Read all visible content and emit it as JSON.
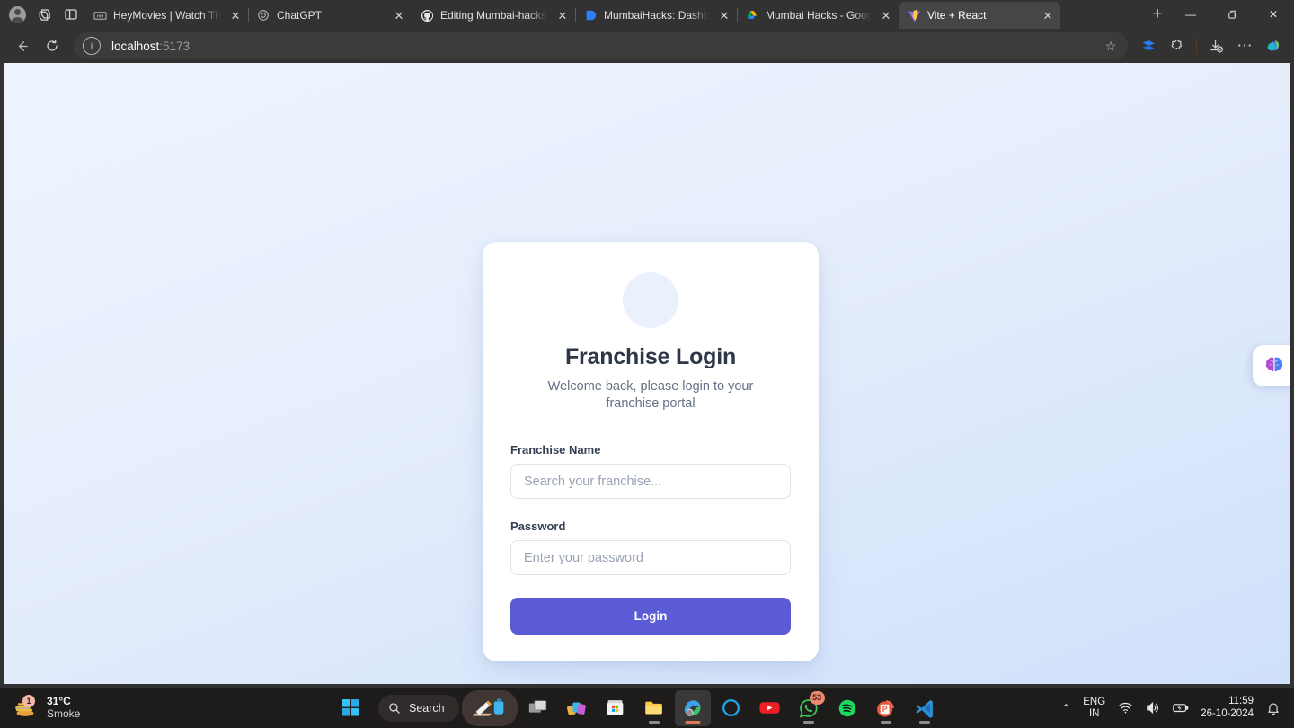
{
  "browser": {
    "profile_icon": "account-avatar-icon",
    "workspaces_icon": "workspaces-icon",
    "tab_actions_icon": "tab-actions-icon",
    "tabs": [
      {
        "title": "HeyMovies | Watch The H",
        "favicon": "heymovies-icon",
        "active": false
      },
      {
        "title": "ChatGPT",
        "favicon": "chatgpt-icon",
        "active": false
      },
      {
        "title": "Editing Mumbai-hacks/RE",
        "favicon": "github-icon",
        "active": false
      },
      {
        "title": "MumbaiHacks: Dashboard",
        "favicon": "dashboard-icon",
        "active": false
      },
      {
        "title": "Mumbai Hacks - Google D",
        "favicon": "google-drive-icon",
        "active": false
      },
      {
        "title": "Vite + React",
        "favicon": "vite-icon",
        "active": true
      }
    ],
    "new_tab_label": "+",
    "window_controls": {
      "minimize": "—",
      "maximize": "❐",
      "close": "✕"
    },
    "nav": {
      "back": "←",
      "reload": "↻"
    },
    "address": {
      "info_icon": "site-info-icon",
      "host": "localhost",
      "port": ":5173"
    },
    "star_label": "☆",
    "toolbar_icons": [
      "split-screen-icon",
      "extensions-icon",
      "downloads-icon",
      "settings-more-icon",
      "copilot-icon"
    ],
    "settings_more_label": "⋯"
  },
  "page": {
    "brand_icon": "brand-avatar-placeholder",
    "title": "Franchise Login",
    "subtitle": "Welcome back, please login to your franchise portal",
    "fields": [
      {
        "label": "Franchise Name",
        "placeholder": "Search your franchise...",
        "value": ""
      },
      {
        "label": "Password",
        "placeholder": "Enter your password",
        "value": ""
      }
    ],
    "submit_label": "Login",
    "accent_color": "#5b5bd6",
    "background_color": "#e9f0fd",
    "side_widget_icon": "brain-assistant-icon"
  },
  "taskbar": {
    "weather": {
      "temperature": "31°C",
      "condition": "Smoke",
      "badge": "1",
      "icon": "weather-smoke-icon"
    },
    "start_icon": "windows-start-icon",
    "search": {
      "icon": "search-icon",
      "label": "Search"
    },
    "apps": [
      {
        "name": "snipping-highlighter-icon",
        "badge": "",
        "state": "pinned-hover"
      },
      {
        "name": "task-view-icon",
        "badge": "",
        "state": ""
      },
      {
        "name": "photos-icon",
        "badge": "",
        "state": ""
      },
      {
        "name": "microsoft-store-icon",
        "badge": "",
        "state": ""
      },
      {
        "name": "file-explorer-icon",
        "badge": "",
        "state": "running"
      },
      {
        "name": "microsoft-edge-icon",
        "badge": "",
        "state": "active"
      },
      {
        "name": "arc-browser-icon",
        "badge": "",
        "state": ""
      },
      {
        "name": "youtube-icon",
        "badge": "",
        "state": ""
      },
      {
        "name": "whatsapp-icon",
        "badge": "53",
        "state": "running"
      },
      {
        "name": "spotify-icon",
        "badge": "",
        "state": ""
      },
      {
        "name": "powerpoint-icon",
        "badge": "",
        "state": "running"
      },
      {
        "name": "vs-code-icon",
        "badge": "",
        "state": "running"
      }
    ],
    "tray": {
      "overflow_label": "⌃",
      "language_line1": "ENG",
      "language_line2": "IN",
      "wifi_icon": "wifi-icon",
      "volume_icon": "volume-icon",
      "battery_icon": "battery-charging-icon",
      "time": "11:59",
      "date": "26-10-2024",
      "notification_icon": "notification-bell-icon"
    }
  }
}
